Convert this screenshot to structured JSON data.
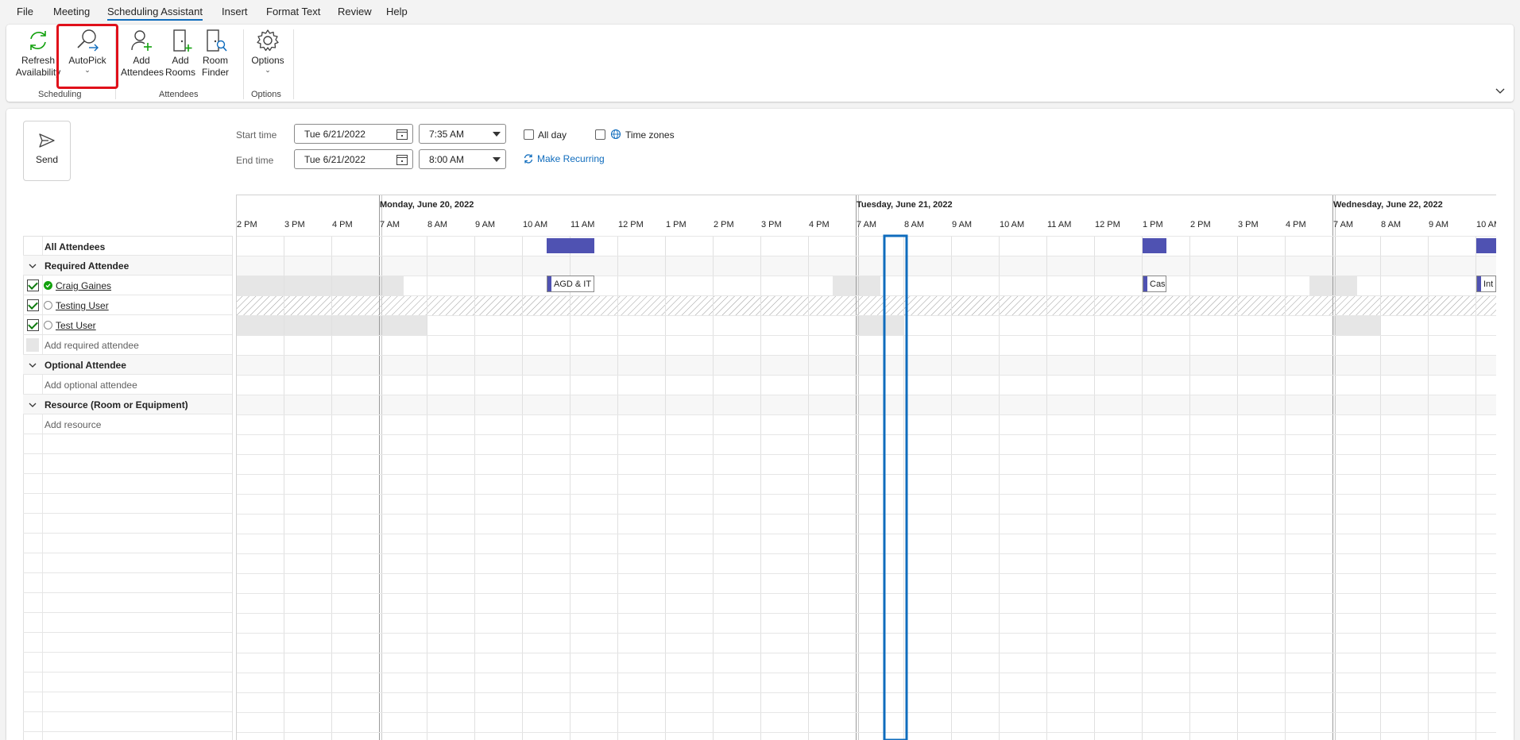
{
  "menu": {
    "tabs": [
      {
        "label": "File"
      },
      {
        "label": "Meeting"
      },
      {
        "label": "Scheduling Assistant",
        "active": true
      },
      {
        "label": "Insert"
      },
      {
        "label": "Format Text"
      },
      {
        "label": "Review"
      },
      {
        "label": "Help"
      }
    ]
  },
  "ribbon": {
    "refresh": {
      "line1": "Refresh",
      "line2": "Availability"
    },
    "autopick": {
      "line1": "AutoPick"
    },
    "add_attendees": {
      "line1": "Add",
      "line2": "Attendees"
    },
    "add_rooms": {
      "line1": "Add",
      "line2": "Rooms"
    },
    "room_finder": {
      "line1": "Room",
      "line2": "Finder"
    },
    "options": {
      "line1": "Options"
    },
    "groups": {
      "scheduling": "Scheduling",
      "attendees": "Attendees",
      "options": "Options"
    }
  },
  "send": {
    "label": "Send"
  },
  "times": {
    "start_label": "Start time",
    "end_label": "End time",
    "start_date": "Tue 6/21/2022",
    "start_time": "7:35 AM",
    "end_date": "Tue 6/21/2022",
    "end_time": "8:00 AM",
    "all_day": "All day",
    "time_zones": "Time zones",
    "make_recurring": "Make Recurring"
  },
  "attendees": {
    "all": "All Attendees",
    "required_group": "Required Attendee",
    "people": [
      {
        "name": "Craig Gaines",
        "status": "accepted"
      },
      {
        "name": "Testing User",
        "status": "none"
      },
      {
        "name": "Test User",
        "status": "none"
      }
    ],
    "add_required": "Add required attendee",
    "optional_group": "Optional Attendee",
    "add_optional": "Add optional attendee",
    "resource_group": "Resource (Room or Equipment)",
    "add_resource": "Add resource"
  },
  "timeline": {
    "days": [
      "Monday, June 20, 2022",
      "Tuesday, June 21, 2022",
      "Wednesday, June 22, 2022"
    ],
    "hours_partial": [
      "2 PM",
      "3 PM",
      "4 PM"
    ],
    "hours": [
      "7 AM",
      "8 AM",
      "9 AM",
      "10 AM",
      "11 AM",
      "12 PM",
      "1 PM",
      "2 PM",
      "3 PM",
      "4 PM"
    ],
    "hours_last": [
      "7 AM",
      "8 AM",
      "9 AM",
      "10 AM"
    ],
    "events": [
      {
        "label": "AGD & IT"
      },
      {
        "label": "Case"
      },
      {
        "label": "Int"
      }
    ]
  },
  "colors": {
    "busy": "#4f52b2",
    "selection": "#0f6cbd",
    "accent": "#0f6cbd",
    "highlight": "#e0101a"
  }
}
